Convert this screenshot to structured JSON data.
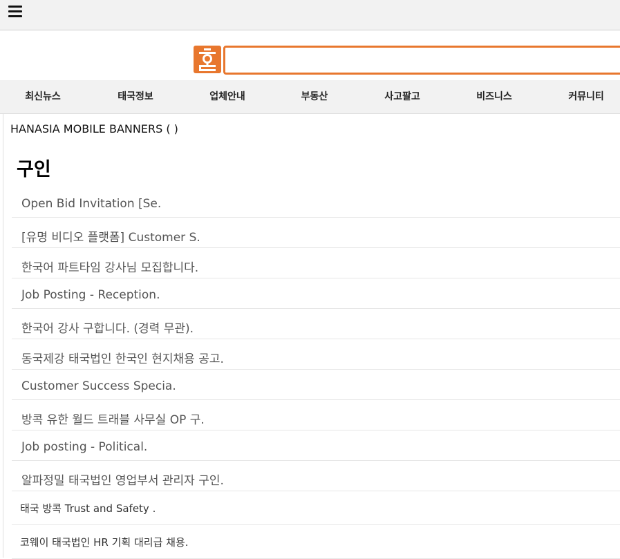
{
  "header": {
    "menu_icon": "hamburger-menu-icon"
  },
  "search": {
    "logo_icon": "hanasia-logo-icon",
    "placeholder": "",
    "value": "",
    "accent_color": "#e8772e"
  },
  "nav": {
    "items": [
      {
        "label": "최신뉴스"
      },
      {
        "label": "태국정보"
      },
      {
        "label": "업체안내"
      },
      {
        "label": "부동산"
      },
      {
        "label": "사고팔고"
      },
      {
        "label": "비즈니스"
      },
      {
        "label": "커뮤니티"
      }
    ]
  },
  "main": {
    "banner_text": "HANASIA MOBILE BANNERS ( )",
    "section_title": "구인",
    "jobs": [
      {
        "title": "Open Bid Invitation [Se."
      },
      {
        "title": "[유명 비디오 플랫폼] Customer S."
      },
      {
        "title": "한국어 파트타임 강사님 모집합니다."
      },
      {
        "title": "Job Posting - Reception."
      },
      {
        "title": "한국어 강사 구합니다. (경력 무관)."
      },
      {
        "title": "동국제강 태국법인 한국인 현지채용 공고."
      },
      {
        "title": "Customer Success Specia."
      },
      {
        "title": "방콕 유한 월드 트래블 사무실 OP 구."
      },
      {
        "title": "Job posting - Political."
      },
      {
        "title": "알파정밀 태국법인 영업부서 관리자 구인."
      },
      {
        "title": "태국 방콕 Trust and Safety ."
      },
      {
        "title": "코웨이 태국법인 HR 기획 대리급 채용."
      }
    ]
  }
}
